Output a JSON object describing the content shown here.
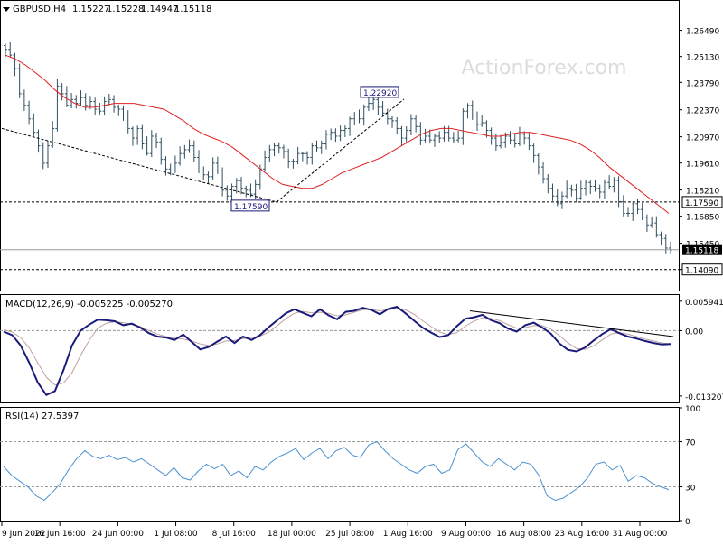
{
  "header": {
    "symbol": "GBPUSD,H4",
    "open": "1.15227",
    "high": "1.15228",
    "low": "1.14947",
    "close": "1.15118"
  },
  "watermark": "ActionForex.com",
  "colors": {
    "background": "#ffffff",
    "candles": "#2f4f5f",
    "moving_average": "#e02020",
    "macd_line": "#1a1a7a",
    "macd_signal": "#c0a0a0",
    "rsi_line": "#4a90d0",
    "trendline": "#000000",
    "grid": "#c8c8c8",
    "label_box": "#1a1a7a"
  },
  "chart_data": [
    {
      "type": "candlestick",
      "panel": "price",
      "ylim": [
        1.13,
        1.275
      ],
      "y_ticks": [
        "1.26490",
        "1.25130",
        "1.23790",
        "1.22370",
        "1.20970",
        "1.19610",
        "1.18210",
        "1.16850",
        "1.15450",
        "1.14090"
      ],
      "x_ticks": [
        "9 Jun 2022",
        "16 Jun 16:00",
        "24 Jun 00:00",
        "1 Jul 08:00",
        "8 Jul 16:00",
        "18 Jul 00:00",
        "25 Jul 08:00",
        "1 Aug 16:00",
        "9 Aug 00:00",
        "16 Aug 08:00",
        "23 Aug 16:00",
        "31 Aug 00:00"
      ],
      "close_path": [
        1.255,
        1.252,
        1.245,
        1.232,
        1.226,
        1.219,
        1.212,
        1.205,
        1.196,
        1.205,
        1.214,
        1.236,
        1.232,
        1.226,
        1.229,
        1.227,
        1.23,
        1.226,
        1.228,
        1.224,
        1.223,
        1.228,
        1.229,
        1.225,
        1.224,
        1.221,
        1.214,
        1.209,
        1.214,
        1.206,
        1.201,
        1.21,
        1.207,
        1.198,
        1.193,
        1.192,
        1.196,
        1.201,
        1.203,
        1.205,
        1.199,
        1.192,
        1.19,
        1.189,
        1.196,
        1.192,
        1.182,
        1.179,
        1.184,
        1.187,
        1.183,
        1.182,
        1.18,
        1.185,
        1.193,
        1.199,
        1.203,
        1.205,
        1.204,
        1.202,
        1.197,
        1.197,
        1.201,
        1.201,
        1.199,
        1.205,
        1.204,
        1.206,
        1.211,
        1.212,
        1.21,
        1.213,
        1.214,
        1.219,
        1.221,
        1.219,
        1.225,
        1.227,
        1.229,
        1.225,
        1.222,
        1.219,
        1.218,
        1.214,
        1.209,
        1.213,
        1.219,
        1.215,
        1.208,
        1.21,
        1.208,
        1.21,
        1.209,
        1.212,
        1.209,
        1.208,
        1.209,
        1.223,
        1.226,
        1.221,
        1.216,
        1.217,
        1.213,
        1.209,
        1.205,
        1.207,
        1.21,
        1.208,
        1.206,
        1.211,
        1.209,
        1.205,
        1.2,
        1.194,
        1.188,
        1.183,
        1.179,
        1.175,
        1.179,
        1.183,
        1.182,
        1.178,
        1.183,
        1.186,
        1.184,
        1.183,
        1.181,
        1.186,
        1.184,
        1.187,
        1.176,
        1.17,
        1.17,
        1.175,
        1.172,
        1.168,
        1.164,
        1.165,
        1.159,
        1.157,
        1.152,
        1.151
      ],
      "moving_average": [
        1.252,
        1.25,
        1.247,
        1.243,
        1.239,
        1.234,
        1.23,
        1.227,
        1.225,
        1.225,
        1.226,
        1.227,
        1.227,
        1.227,
        1.226,
        1.225,
        1.224,
        1.221,
        1.218,
        1.214,
        1.211,
        1.209,
        1.207,
        1.204,
        1.2,
        1.196,
        1.192,
        1.188,
        1.185,
        1.184,
        1.183,
        1.183,
        1.185,
        1.188,
        1.191,
        1.193,
        1.195,
        1.197,
        1.199,
        1.202,
        1.205,
        1.208,
        1.211,
        1.213,
        1.214,
        1.214,
        1.213,
        1.212,
        1.211,
        1.21,
        1.21,
        1.211,
        1.212,
        1.212,
        1.211,
        1.21,
        1.209,
        1.208,
        1.206,
        1.203,
        1.199,
        1.194,
        1.19,
        1.186,
        1.182,
        1.178,
        1.174,
        1.17
      ],
      "trendlines": [
        {
          "from": [
            "9 Jun 2022",
            1.214
          ],
          "to": [
            "8 Jul 16:00",
            1.1759
          ],
          "style": "dashed"
        },
        {
          "from": [
            "18 Jul 00:00",
            1.1759
          ],
          "to": [
            "1 Aug 16:00",
            1.2292
          ],
          "style": "dashed"
        }
      ],
      "horizontal_lines": [
        {
          "value": 1.1759,
          "label": "1.17590"
        },
        {
          "value": 1.1409,
          "label": "1.14090"
        }
      ],
      "annotations": [
        {
          "text": "1.22920",
          "value": 1.2292
        },
        {
          "text": "1.17590",
          "value": 1.1759
        }
      ],
      "current_price": "1.15118"
    },
    {
      "type": "line",
      "panel": "MACD",
      "title": "MACD(12,26,9) -0.005225 -0.005270",
      "ylim": [
        -0.0145,
        0.007
      ],
      "y_ticks": [
        "0.005941",
        "0.00",
        "-0.013207"
      ],
      "macd": [
        -0.0002,
        -0.0009,
        -0.003,
        -0.0065,
        -0.0105,
        -0.013,
        -0.0122,
        -0.008,
        -0.003,
        0.0,
        0.0012,
        0.0022,
        0.0021,
        0.0019,
        0.0011,
        0.0014,
        0.0006,
        -0.0005,
        -0.0012,
        -0.0014,
        -0.0019,
        -0.0008,
        -0.0023,
        -0.0038,
        -0.0033,
        -0.0022,
        -0.0012,
        -0.0025,
        -0.0012,
        -0.0019,
        -0.0009,
        0.0007,
        0.0021,
        0.0035,
        0.0043,
        0.0036,
        0.0029,
        0.0043,
        0.0031,
        0.0023,
        0.0038,
        0.004,
        0.0046,
        0.0042,
        0.0033,
        0.0044,
        0.0048,
        0.0035,
        0.002,
        0.0006,
        -0.0004,
        -0.0013,
        -0.0009,
        0.0009,
        0.0024,
        0.0027,
        0.0032,
        0.0021,
        0.0015,
        0.0004,
        -0.0002,
        0.0011,
        0.0016,
        0.0006,
        -0.0006,
        -0.0026,
        -0.0039,
        -0.0042,
        -0.0034,
        -0.002,
        -0.0007,
        0.0003,
        -0.0005,
        -0.0012,
        -0.0016,
        -0.0021,
        -0.0025,
        -0.0028,
        -0.0027
      ],
      "signal": [
        0.0002,
        -0.0003,
        -0.0014,
        -0.0035,
        -0.0065,
        -0.0094,
        -0.011,
        -0.0106,
        -0.0085,
        -0.005,
        -0.002,
        0.0005,
        0.0015,
        0.0018,
        0.0016,
        0.0012,
        0.0008,
        0.0,
        -0.0007,
        -0.0012,
        -0.0015,
        -0.0017,
        -0.0021,
        -0.0027,
        -0.003,
        -0.0027,
        -0.0021,
        -0.002,
        -0.0016,
        -0.0014,
        -0.0011,
        -0.0003,
        0.001,
        0.0024,
        0.0035,
        0.0039,
        0.0036,
        0.0037,
        0.0035,
        0.003,
        0.0032,
        0.0037,
        0.0042,
        0.0043,
        0.004,
        0.0042,
        0.0045,
        0.0042,
        0.0033,
        0.002,
        0.0008,
        -0.0003,
        -0.0008,
        -0.0004,
        0.0009,
        0.0019,
        0.0026,
        0.0025,
        0.002,
        0.0012,
        0.0005,
        0.0006,
        0.001,
        0.001,
        0.0003,
        -0.001,
        -0.0025,
        -0.0036,
        -0.0038,
        -0.0031,
        -0.0019,
        -0.0007,
        -0.0004,
        -0.0007,
        -0.0012,
        -0.0017,
        -0.0021,
        -0.0025,
        -0.0027
      ],
      "trendline": {
        "from": [
          "9 Aug 00:00",
          0.004
        ],
        "to": [
          "31 Aug 00:00",
          -0.0012
        ]
      }
    },
    {
      "type": "line",
      "panel": "RSI",
      "title": "RSI(14) 27.5397",
      "ylim": [
        0,
        100
      ],
      "y_ticks": [
        "100",
        "70",
        "30",
        "0"
      ],
      "levels": [
        70,
        30
      ],
      "rsi": [
        48,
        40,
        35,
        30,
        22,
        18,
        25,
        33,
        45,
        55,
        62,
        57,
        55,
        58,
        54,
        56,
        52,
        55,
        50,
        45,
        40,
        47,
        38,
        36,
        44,
        50,
        46,
        50,
        40,
        44,
        38,
        48,
        45,
        52,
        57,
        60,
        64,
        54,
        60,
        64,
        55,
        62,
        65,
        58,
        56,
        67,
        70,
        62,
        55,
        50,
        45,
        42,
        48,
        50,
        42,
        45,
        63,
        68,
        60,
        52,
        48,
        55,
        50,
        45,
        52,
        50,
        40,
        22,
        18,
        20,
        25,
        30,
        38,
        50,
        52,
        45,
        49,
        35,
        40,
        38,
        33,
        30,
        27.54
      ]
    }
  ]
}
